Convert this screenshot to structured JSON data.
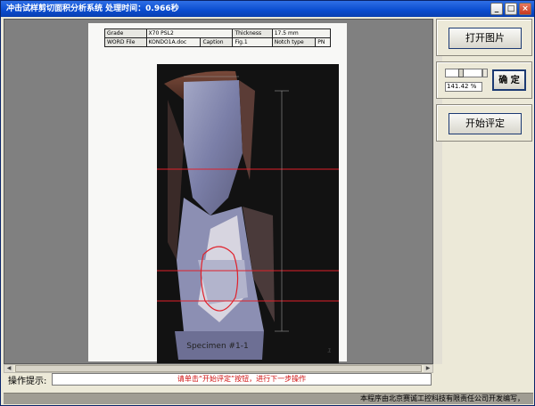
{
  "window": {
    "title": "冲击试样剪切面积分析系统   处理时间：0.966秒",
    "minimize_glyph": "_",
    "maximize_glyph": "□",
    "close_glyph": "×"
  },
  "document": {
    "table": [
      [
        {
          "label": "Grade",
          "value": "X70 PSL2"
        },
        {
          "label": "Thickness",
          "value": "17.5 mm"
        }
      ],
      [
        {
          "label": "WORD File",
          "value": "KONDO1A.doc"
        },
        {
          "label": "Caption",
          "value": "Fig.1"
        },
        {
          "label": "Notch type",
          "value": "PN"
        }
      ]
    ],
    "specimen_caption": "Specimen #1-1",
    "page_number": "1"
  },
  "controls": {
    "open_image_label": "打开图片",
    "zoom_value": "141.42 %",
    "confirm_label": "确 定",
    "start_label": "开始评定"
  },
  "hint": {
    "label": "操作提示:",
    "message": "请单击“开始评定”按钮，进行下一步操作"
  },
  "status": {
    "text": "本程序由北京赛诚工控科技有限责任公司开发编写，"
  },
  "colors": {
    "measure_line": "#e0202a",
    "hint_text": "#d01010",
    "title_bar": "#0a4ccf"
  }
}
